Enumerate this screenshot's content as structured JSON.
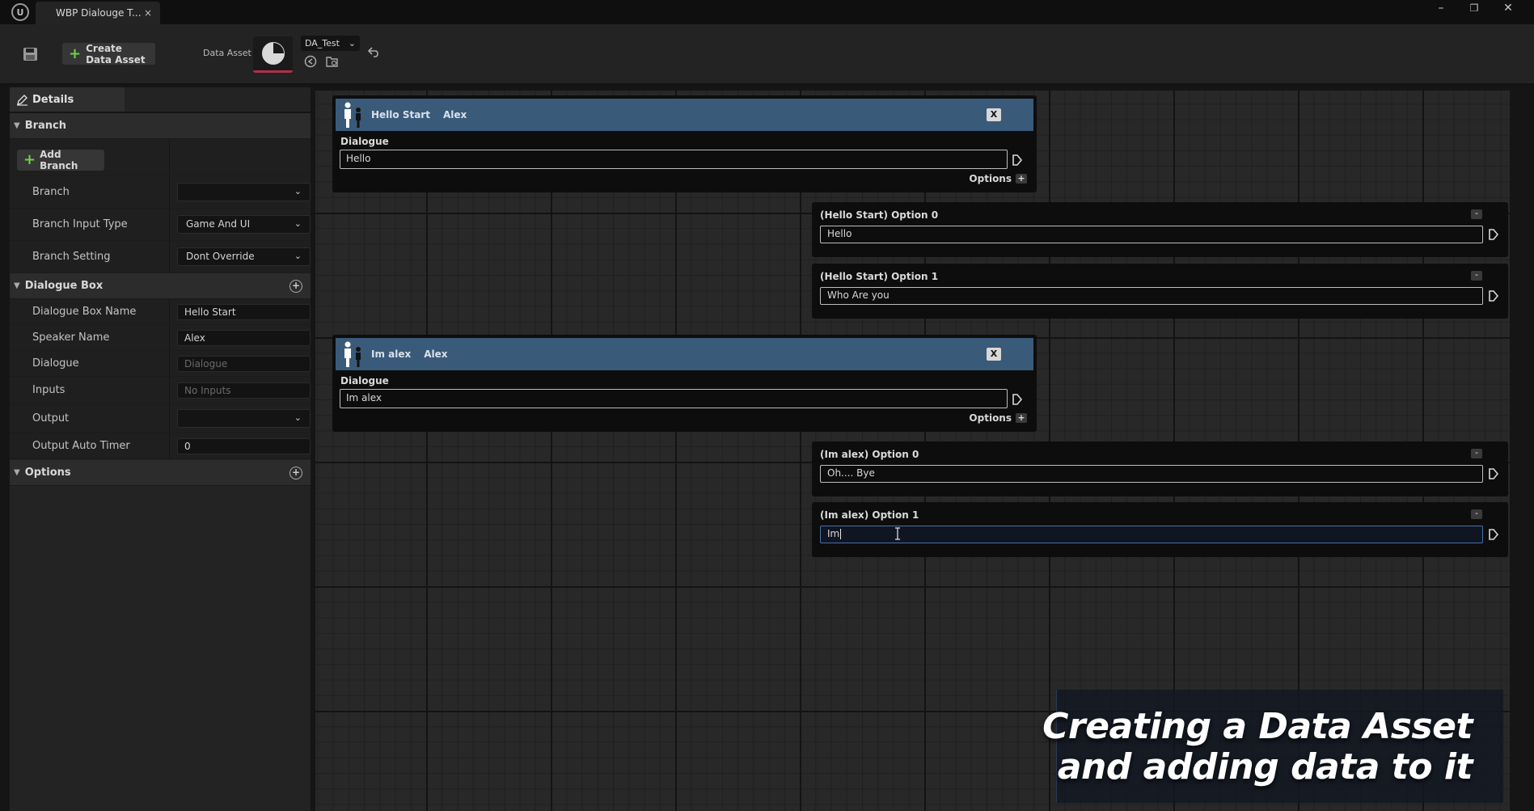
{
  "window": {
    "tab_title": "WBP Dialouge T...",
    "tab_close": "×",
    "logo_glyph": "U",
    "controls": {
      "minimize": "–",
      "maximize": "❐",
      "close": "✕"
    }
  },
  "toolbar": {
    "create_label": "Create Data Asset",
    "data_asset_label": "Data Asset",
    "data_asset_value": "DA_Test"
  },
  "details": {
    "tab_label": "Details",
    "branch_section": {
      "title": "Branch",
      "add_button": "Add Branch",
      "rows": [
        {
          "label": "Branch",
          "value": ""
        },
        {
          "label": "Branch Input Type",
          "value": "Game And UI"
        },
        {
          "label": "Branch Setting",
          "value": "Dont Override"
        }
      ]
    },
    "dialogue_section": {
      "title": "Dialogue Box",
      "name_label": "Dialogue Box Name",
      "name_value": "Hello Start",
      "speaker_label": "Speaker Name",
      "speaker_value": "Alex",
      "dialogue_label": "Dialogue",
      "dialogue_placeholder": "Dialogue",
      "inputs_label": "Inputs",
      "inputs_placeholder": "No Inputs",
      "output_label": "Output",
      "output_value": "",
      "timer_label": "Output Auto Timer",
      "timer_value": "0"
    },
    "options_section": {
      "title": "Options"
    }
  },
  "nodes": [
    {
      "name": "Hello Start",
      "speaker": "Alex",
      "close": "X",
      "dialogue_label": "Dialogue",
      "dialogue": "Hello",
      "options_label": "Options",
      "options": [
        {
          "label": "(Hello Start) Option 0",
          "value": "Hello"
        },
        {
          "label": "(Hello Start) Option 1",
          "value": "Who Are you"
        }
      ]
    },
    {
      "name": "Im alex",
      "speaker": "Alex",
      "close": "X",
      "dialogue_label": "Dialogue",
      "dialogue": "Im alex",
      "options_label": "Options",
      "options": [
        {
          "label": "(Im alex) Option 0",
          "value": "Oh.... Bye"
        },
        {
          "label": "(Im alex) Option 1",
          "value": "Im"
        }
      ]
    }
  ],
  "caption": {
    "line1": "Creating a Data Asset",
    "line2": "and adding data to it"
  },
  "colors": {
    "node_header": "#3a5a7a",
    "accent_green": "#6fd14a",
    "thumb_underline": "#b0304a"
  }
}
